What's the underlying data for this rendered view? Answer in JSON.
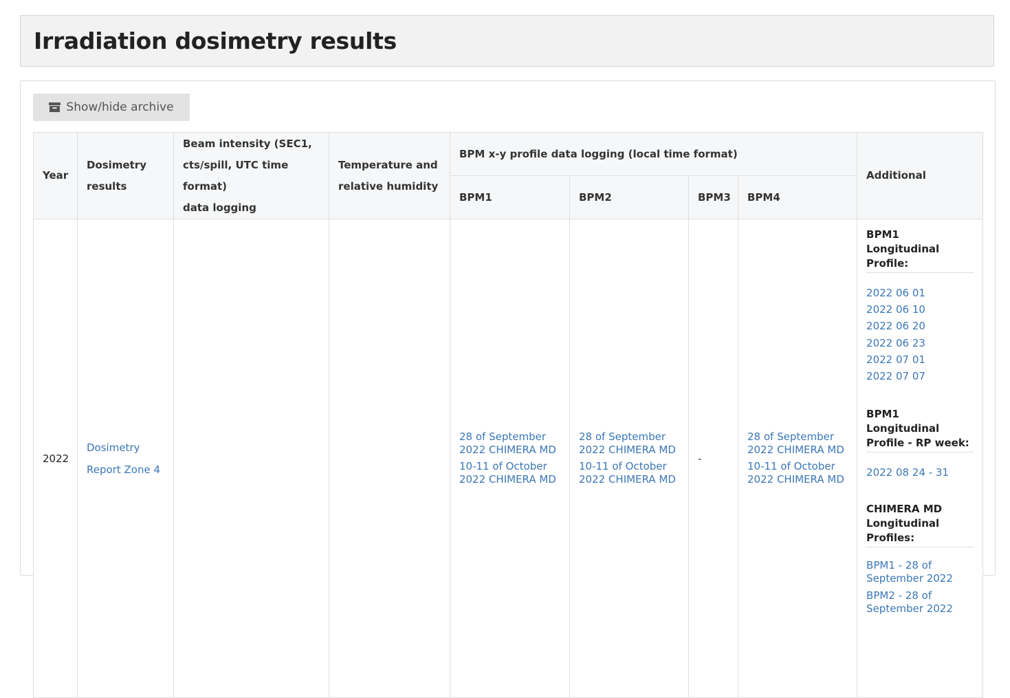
{
  "page": {
    "title": "Irradiation dosimetry results",
    "archive_button_label": "Show/hide archive"
  },
  "table": {
    "headers": {
      "year": "Year",
      "dosimetry": [
        "Dosimetry",
        "results"
      ],
      "beam": [
        "Beam intensity (SEC1,",
        "cts/spill, UTC time format)",
        "data logging"
      ],
      "temperature": [
        "Temperature and",
        "relative humidity"
      ],
      "bpm_group": "BPM x-y profile data logging (local time format)",
      "bpm1": "BPM1",
      "bpm2": "BPM2",
      "bpm3": "BPM3",
      "bpm4": "BPM4",
      "additional": "Additional"
    },
    "row_2022": {
      "year": "2022",
      "dosimetry_link": [
        "Dosimetry",
        "Report Zone 4"
      ],
      "beam": "",
      "temperature": "",
      "bpm1_links": [
        "28 of September 2022 CHIMERA MD",
        "10-11 of October 2022 CHIMERA MD"
      ],
      "bpm2_links": [
        "28 of September 2022 CHIMERA MD",
        "10-11 of October 2022 CHIMERA MD"
      ],
      "bpm3": "-",
      "bpm4_links": [
        "28 of September 2022 CHIMERA MD",
        "10-11 of October 2022 CHIMERA MD"
      ],
      "additional": {
        "section1_title": "BPM1 Longitudinal Profile:",
        "section1_links": [
          "2022 06 01",
          "2022 06 10",
          "2022 06 20",
          "2022 06 23",
          "2022 07 01",
          "2022 07 07"
        ],
        "section2_title": "BPM1 Longitudinal Profile - RP week:",
        "section2_links": [
          "2022 08 24 - 31"
        ],
        "section3_title": "CHIMERA MD Longitudinal Profiles:",
        "section3_links": [
          "BPM1 - 28 of September 2022",
          "BPM2 - 28 of September 2022"
        ]
      }
    }
  },
  "colors": {
    "link": "#3b77b5",
    "header_bg": "#f6f7f8",
    "panel_bg": "#f2f2f2",
    "button_bg": "#e3e3e3"
  },
  "icons": {
    "archive": "archive-icon"
  }
}
